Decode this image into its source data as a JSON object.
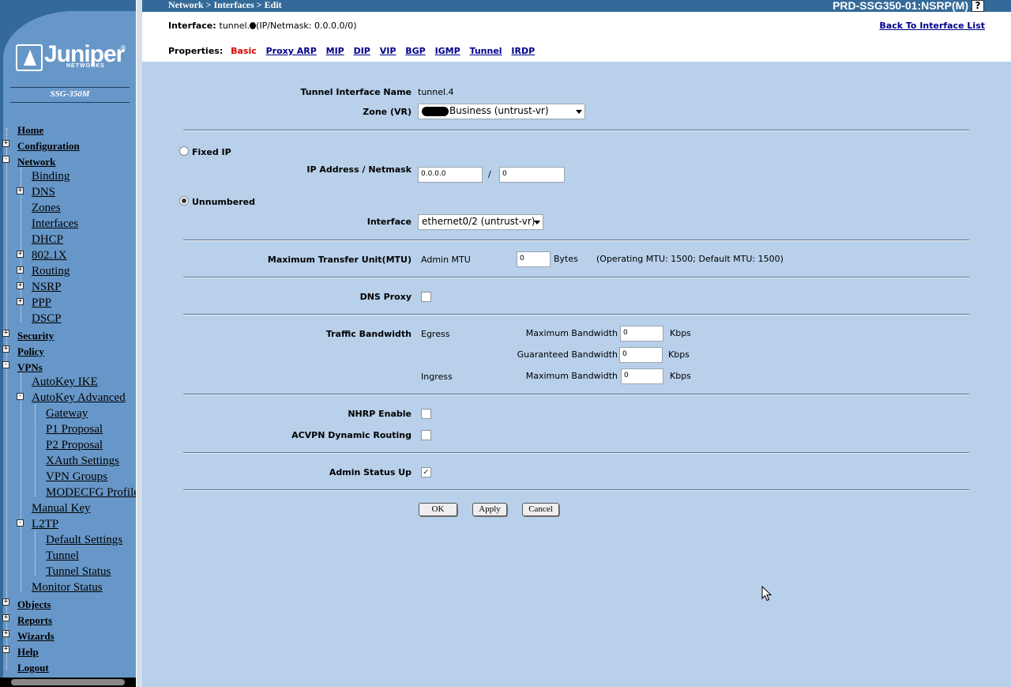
{
  "sidebar": {
    "brand": "Juniper",
    "brand_sub": "NETWORKS",
    "model": "SSG-350M",
    "nav": [
      {
        "label": "Home"
      },
      {
        "label": "Configuration"
      },
      {
        "label": "Network"
      },
      {
        "label": "Binding"
      },
      {
        "label": "DNS"
      },
      {
        "label": "Zones"
      },
      {
        "label": "Interfaces"
      },
      {
        "label": "DHCP"
      },
      {
        "label": "802.1X"
      },
      {
        "label": "Routing"
      },
      {
        "label": "NSRP"
      },
      {
        "label": "PPP"
      },
      {
        "label": "DSCP"
      },
      {
        "label": "Security"
      },
      {
        "label": "Policy"
      },
      {
        "label": "VPNs"
      },
      {
        "label": "AutoKey IKE"
      },
      {
        "label": "AutoKey Advanced"
      },
      {
        "label": "Gateway"
      },
      {
        "label": "P1 Proposal"
      },
      {
        "label": "P2 Proposal"
      },
      {
        "label": "XAuth Settings"
      },
      {
        "label": "VPN Groups"
      },
      {
        "label": "MODECFG Profile"
      },
      {
        "label": "Manual Key"
      },
      {
        "label": "L2TP"
      },
      {
        "label": "Default Settings"
      },
      {
        "label": "Tunnel"
      },
      {
        "label": "Tunnel Status"
      },
      {
        "label": "Monitor Status"
      },
      {
        "label": "Objects"
      },
      {
        "label": "Reports"
      },
      {
        "label": "Wizards"
      },
      {
        "label": "Help"
      },
      {
        "label": "Logout"
      }
    ]
  },
  "topbar": {
    "breadcrumb": "Network > Interfaces > Edit",
    "device": "PRD-SSG350-01:NSRP(M)",
    "help": "?"
  },
  "header": {
    "interface_label": "Interface:",
    "interface_value": "tunnel.",
    "interface_ipmask": "(IP/Netmask: 0.0.0.0/0)",
    "back_link": "Back To Interface List",
    "properties_label": "Properties:",
    "tabs": [
      "Basic",
      "Proxy ARP",
      "MIP",
      "DIP",
      "VIP",
      "BGP",
      "IGMP",
      "Tunnel",
      "IRDP"
    ]
  },
  "form": {
    "tunnel_name_label": "Tunnel Interface Name",
    "tunnel_name_value": "tunnel.4",
    "zone_label": "Zone (VR)",
    "zone_value": "Business (untrust-vr)",
    "fixed_ip_label": "Fixed IP",
    "ip_mask_label": "IP Address / Netmask",
    "ip_value": "0.0.0.0",
    "slash": "/",
    "mask_value": "0",
    "unnumbered_label": "Unnumbered",
    "interface_label": "Interface",
    "interface_value": "ethernet0/2 (untrust-vr)",
    "mtu_label": "Maximum Transfer Unit(MTU)",
    "admin_mtu_label": "Admin MTU",
    "admin_mtu_value": "0",
    "bytes": "Bytes",
    "mtu_info": "(Operating MTU: 1500; Default MTU: 1500)",
    "dns_proxy_label": "DNS Proxy",
    "traffic_label": "Traffic Bandwidth",
    "egress": "Egress",
    "ingress": "Ingress",
    "max_bw_label": "Maximum Bandwidth",
    "guar_bw_label": "Guaranteed Bandwidth",
    "egress_max": "0",
    "egress_guar": "0",
    "ingress_max": "0",
    "kbps": "Kbps",
    "nhrp_label": "NHRP Enable",
    "acvpn_label": "ACVPN Dynamic Routing",
    "admin_status_label": "Admin Status Up",
    "check_mark": "✓",
    "ok": "OK",
    "apply": "Apply",
    "cancel": "Cancel"
  }
}
